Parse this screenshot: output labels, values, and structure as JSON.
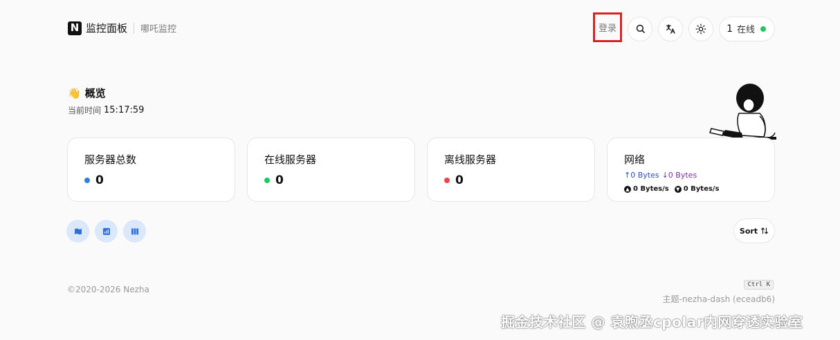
{
  "header": {
    "logo_letter": "N",
    "title": "监控面板",
    "subtitle": "哪吒监控",
    "login_label": "登录",
    "online_count": "1",
    "online_label": "在线"
  },
  "overview": {
    "emoji": "👋",
    "title": "概览",
    "time_label": "当前时间",
    "time_value": "15:17:59"
  },
  "cards": {
    "total": {
      "title": "服务器总数",
      "value": "0",
      "dot_color": "#2f7fe0"
    },
    "online": {
      "title": "在线服务器",
      "value": "0",
      "dot_color": "#22c55e"
    },
    "offline": {
      "title": "离线服务器",
      "value": "0",
      "dot_color": "#ef4444"
    },
    "network": {
      "title": "网络",
      "up": "↑0 Bytes",
      "down": "↓0 Bytes",
      "up_speed": "0 Bytes/s",
      "down_speed": "0 Bytes/s"
    }
  },
  "views": {
    "icons": [
      "map-icon",
      "bar-chart-icon",
      "columns-icon"
    ]
  },
  "sort": {
    "label": "Sort"
  },
  "footer": {
    "copyright": "©2020-2026 Nezha",
    "shortcut": "Ctrl K",
    "theme": "主题-nezha-dash (eceadb6)"
  },
  "watermark": "掘金技术社区 @ 袁煦丞cpolar内网穿透实验室",
  "colors": {
    "accent_blue": "#2f7fe0",
    "view_bg": "#dbe7fb",
    "login_border": "#d92323"
  }
}
